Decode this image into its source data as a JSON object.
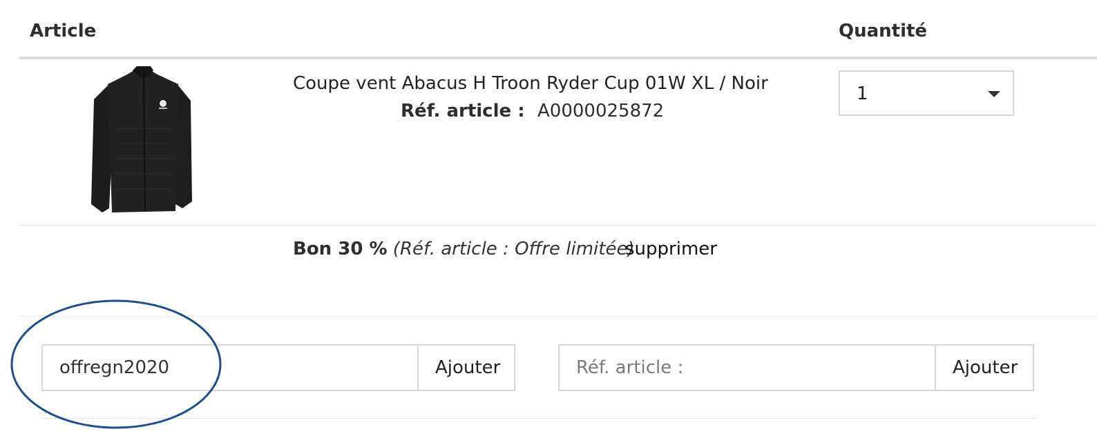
{
  "table": {
    "header_article": "Article",
    "header_quantity": "Quantité"
  },
  "cart_item": {
    "image_alt": "Coupe vent noir",
    "name": "Coupe vent Abacus H Troon Ryder Cup 01W XL / Noir",
    "ref_label": "Réf. article :",
    "ref_value": "A0000025872",
    "quantity": "1"
  },
  "voucher": {
    "name": "Bon 30 %",
    "note": "(Réf. article : Offre limitée)",
    "remove_label": "supprimer"
  },
  "voucher_form": {
    "value": "offregn2020",
    "button_label": "Ajouter"
  },
  "article_form": {
    "placeholder": "Réf. article :",
    "value": "",
    "button_label": "Ajouter"
  },
  "colors": {
    "highlight": "#1f4e8c",
    "border": "#d6d6d6",
    "text": "#2b2b2b"
  },
  "icons": {
    "quantity_dropdown": "caret-down-icon"
  }
}
